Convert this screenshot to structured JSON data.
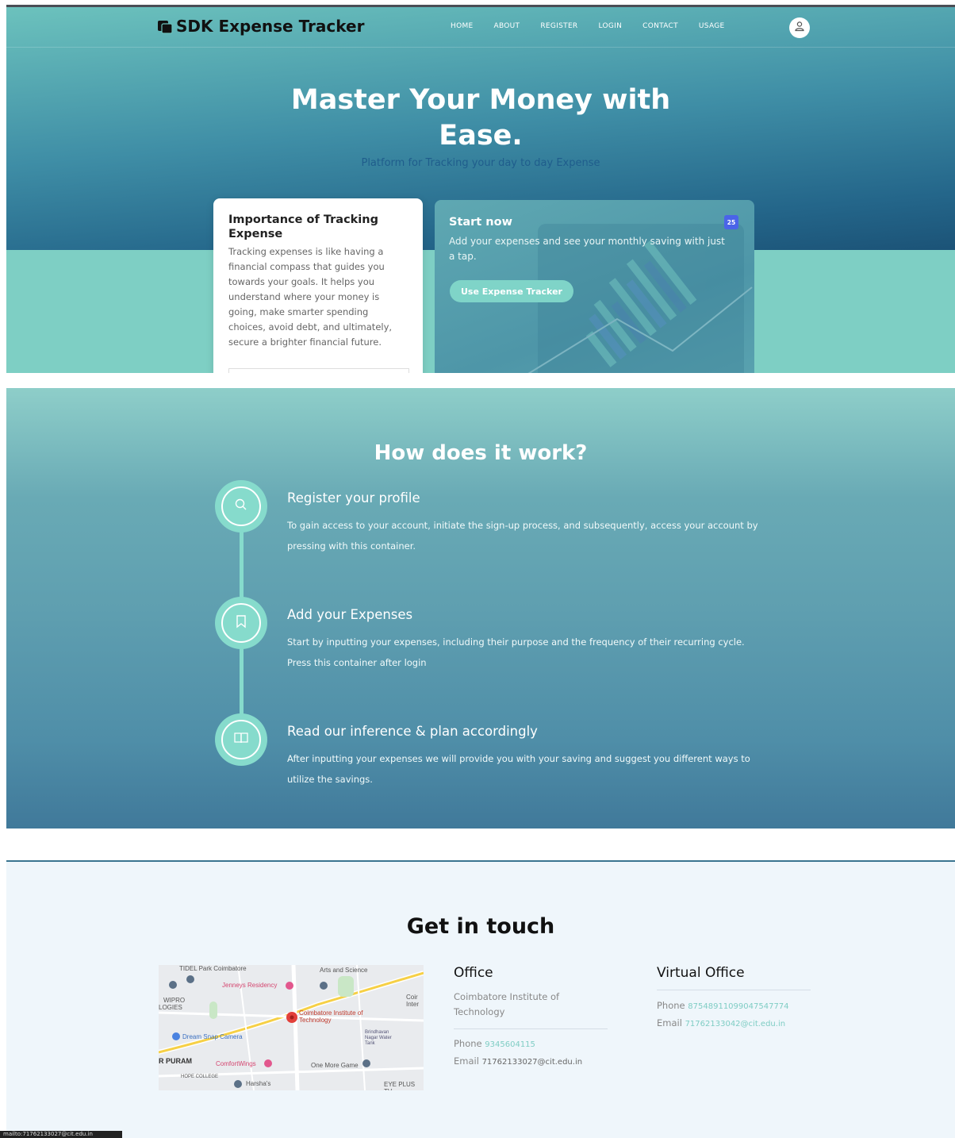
{
  "app": {
    "title": "SDK Expense Tracker"
  },
  "nav": {
    "items": [
      "HOME",
      "ABOUT",
      "REGISTER",
      "LOGIN",
      "CONTACT",
      "USAGE"
    ]
  },
  "hero": {
    "title_line1": "Master Your Money with",
    "title_line2": "Ease.",
    "subtitle": "Platform for Tracking your day to day Expense"
  },
  "importance_card": {
    "title": "Importance of Tracking Expense",
    "body": "Tracking expenses is like having a financial compass that guides you towards your goals. It helps you understand where your money is going, make smarter spending choices, avoid debt, and ultimately, secure a brighter financial future."
  },
  "start_card": {
    "title": "Start now",
    "body": "Add your expenses and see your monthly saving with just a tap.",
    "badge": "25",
    "button_label": "Use Expense Tracker"
  },
  "how": {
    "title": "How does it work?",
    "steps": [
      {
        "title": "Register your profile",
        "text": "To gain access to your account, initiate the sign-up process, and subsequently, access your account by pressing with this container.",
        "icon": "search-icon"
      },
      {
        "title": "Add your Expenses",
        "text": "Start by inputting your expenses, including their purpose and the frequency of their recurring cycle. Press this container after login",
        "icon": "bookmark-icon"
      },
      {
        "title": "Read our inference & plan accordingly",
        "text": "After inputting your expenses we will provide you with your saving and suggest you different ways to utilize the savings.",
        "icon": "book-icon"
      }
    ]
  },
  "contact": {
    "title": "Get in touch",
    "map_labels": {
      "tidel": "TIDEL Park Coimbatore",
      "arts": "Arts and Science",
      "jenneys": "Jenneys Residency",
      "wipro": "WIPRO",
      "logies": "LOGIES",
      "cit": "Coimbatore Institute of Technology",
      "dream": "Dream Snap Camera",
      "rpuram": "R PURAM",
      "comfort": "ComfortWings",
      "onemore": "One More Game",
      "hope": "HOPE COLLEGE",
      "harsha": "Harsha's",
      "eyeplus": "EYE PLUS TV",
      "coin": "Coir Inter",
      "brindavan": "Brindhavan Nagar Water Tank"
    },
    "office": {
      "heading": "Office",
      "address": "Coimbatore Institute of Technology",
      "phone_label": "Phone",
      "phone": "9345604115",
      "email_label": "Email",
      "email": "71762133027@cit.edu.in"
    },
    "virtual_office": {
      "heading": "Virtual Office",
      "phone_label": "Phone",
      "phone": "87548911099047547774",
      "email_label": "Email",
      "email": "71762133042@cit.edu.in"
    }
  },
  "status_bar": {
    "text": "mailto:71762133027@cit.edu.in"
  },
  "colors": {
    "accent": "#86dbcc",
    "badge": "#4a64e8",
    "dark_text": "#111111"
  }
}
